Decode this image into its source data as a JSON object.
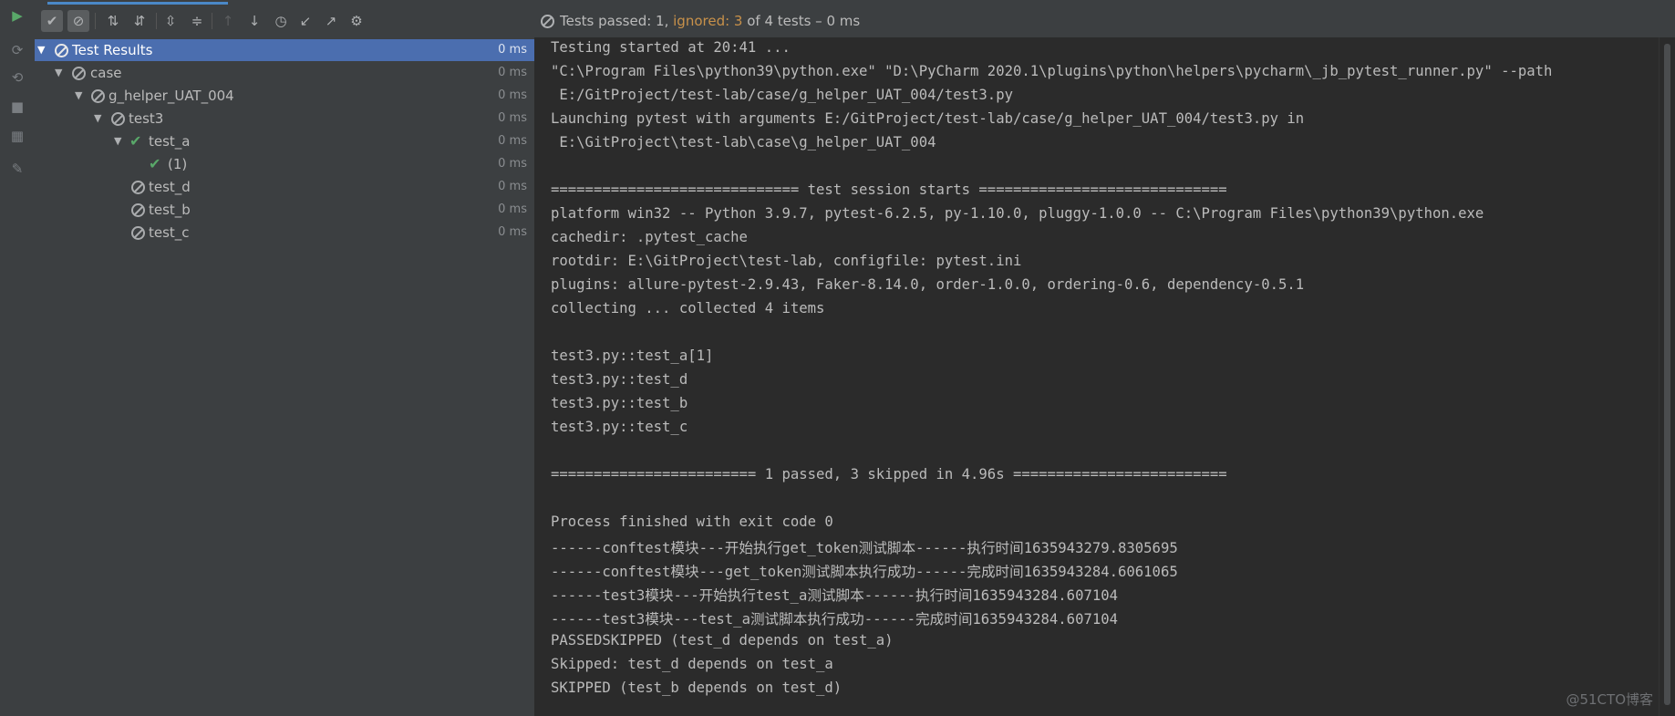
{
  "status": {
    "passed_label": "Tests passed: 1,",
    "ignored_label": "ignored: 3",
    "rest_label": "of 4 tests – 0 ms"
  },
  "toolbar": {
    "icons": [
      "run-icon",
      "show-passed-icon",
      "show-ignored-icon",
      "sort-alpha-icon",
      "sort-duration-icon",
      "expand-all-icon",
      "collapse-all-icon",
      "prev-failed-icon",
      "next-failed-icon",
      "history-icon",
      "import-icon",
      "export-icon",
      "settings-icon"
    ]
  },
  "tree": {
    "rows": [
      {
        "label": "Test Results",
        "duration": "0 ms",
        "status": "ignored",
        "level": 0,
        "expanded": true,
        "selected": true
      },
      {
        "label": "case",
        "duration": "0 ms",
        "status": "ignored",
        "level": 1,
        "expanded": true
      },
      {
        "label": "g_helper_UAT_004",
        "duration": "0 ms",
        "status": "ignored",
        "level": 2,
        "expanded": true
      },
      {
        "label": "test3",
        "duration": "0 ms",
        "status": "ignored",
        "level": 3,
        "expanded": true
      },
      {
        "label": "test_a",
        "duration": "0 ms",
        "status": "passed",
        "level": 4,
        "expanded": true
      },
      {
        "label": "(1)",
        "duration": "0 ms",
        "status": "passed",
        "level": 5
      },
      {
        "label": "test_d",
        "duration": "0 ms",
        "status": "ignored",
        "level": 4
      },
      {
        "label": "test_b",
        "duration": "0 ms",
        "status": "ignored",
        "level": 4
      },
      {
        "label": "test_c",
        "duration": "0 ms",
        "status": "ignored",
        "level": 4
      }
    ]
  },
  "console": {
    "lines": [
      "Testing started at 20:41 ...",
      "\"C:\\Program Files\\python39\\python.exe\" \"D:\\PyCharm 2020.1\\plugins\\python\\helpers\\pycharm\\_jb_pytest_runner.py\" --path",
      " E:/GitProject/test-lab/case/g_helper_UAT_004/test3.py",
      "Launching pytest with arguments E:/GitProject/test-lab/case/g_helper_UAT_004/test3.py in",
      " E:\\GitProject\\test-lab\\case\\g_helper_UAT_004",
      "",
      "============================= test session starts =============================",
      "platform win32 -- Python 3.9.7, pytest-6.2.5, py-1.10.0, pluggy-1.0.0 -- C:\\Program Files\\python39\\python.exe",
      "cachedir: .pytest_cache",
      "rootdir: E:\\GitProject\\test-lab, configfile: pytest.ini",
      "plugins: allure-pytest-2.9.43, Faker-8.14.0, order-1.0.0, ordering-0.6, dependency-0.5.1",
      "collecting ... collected 4 items",
      "",
      "test3.py::test_a[1]",
      "test3.py::test_d",
      "test3.py::test_b",
      "test3.py::test_c",
      "",
      "======================== 1 passed, 3 skipped in 4.96s =========================",
      "",
      "Process finished with exit code 0",
      "------conftest模块---开始执行get_token测试脚本------执行时间1635943279.8305695",
      "------conftest模块---get_token测试脚本执行成功------完成时间1635943284.6061065",
      "------test3模块---开始执行test_a测试脚本------执行时间1635943284.607104",
      "------test3模块---test_a测试脚本执行成功------完成时间1635943284.607104",
      "PASSEDSKIPPED (test_d depends on test_a)",
      "Skipped: test_d depends on test_a",
      "SKIPPED (test_b depends on test_d)"
    ]
  },
  "watermark": "@51CTO博客",
  "colors": {
    "selection": "#4b6eaf",
    "passed": "#59a869",
    "ignored_text": "#c8914a"
  }
}
